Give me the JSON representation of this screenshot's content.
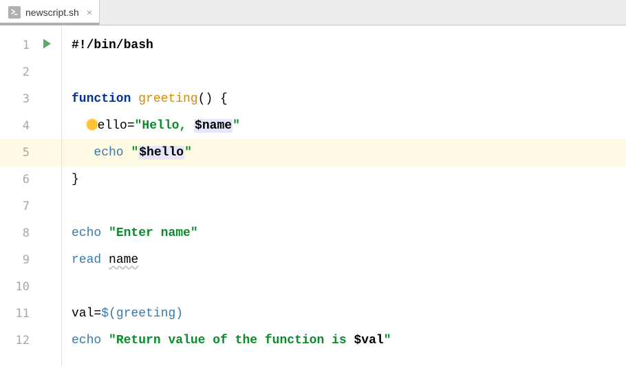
{
  "tab": {
    "filename": "newscript.sh",
    "close_char": "×"
  },
  "gutter": {
    "lines": [
      "1",
      "2",
      "3",
      "4",
      "5",
      "6",
      "7",
      "8",
      "9",
      "10",
      "11",
      "12"
    ]
  },
  "code": {
    "l1": {
      "shebang": "#!/bin/bash"
    },
    "l3": {
      "kw": "function",
      "name": "greeting",
      "paren": "() {"
    },
    "l4": {
      "varpart": "ello=",
      "str_open": "\"Hello, ",
      "varref": "$name",
      "str_close": "\""
    },
    "l5": {
      "cmd": "echo",
      "str_open": "\"",
      "varref": "$hello",
      "str_close": "\""
    },
    "l6": {
      "brace": "}"
    },
    "l8": {
      "cmd": "echo",
      "str": "\"Enter name\""
    },
    "l9": {
      "cmd": "read",
      "arg": "name"
    },
    "l11": {
      "lhs": "val=",
      "dollar": "$(",
      "fn": "greeting",
      "close": ")"
    },
    "l12": {
      "cmd": "echo",
      "str_open": "\"Return value of the function is ",
      "varref": "$val",
      "str_close": "\""
    }
  }
}
